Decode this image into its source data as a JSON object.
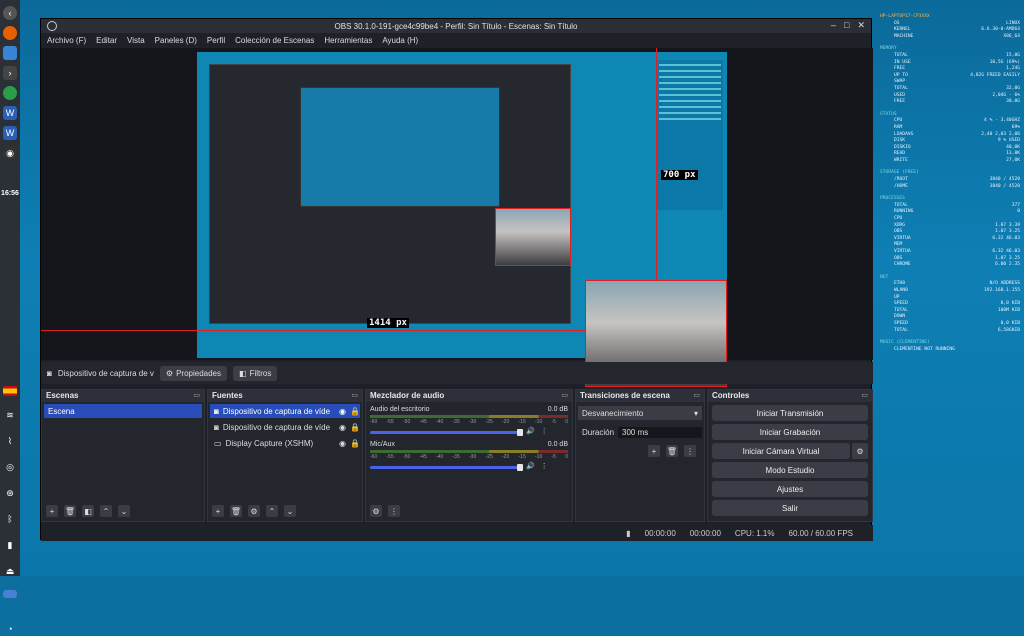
{
  "taskbar": {
    "time": "16:56"
  },
  "window": {
    "title": "OBS 30.1.0-191-gce4c99be4 - Perfil: Sin Título - Escenas: Sin Título"
  },
  "menu": [
    "Archivo (F)",
    "Editar",
    "Vista",
    "Paneles (D)",
    "Perfil",
    "Colección de Escenas",
    "Herramientas",
    "Ayuda (H)"
  ],
  "preview": {
    "label1": "700 px",
    "label2": "1414 px"
  },
  "sourcebar": {
    "source": "Dispositivo de captura de v",
    "props": "Propiedades",
    "filters": "Filtros"
  },
  "docks": {
    "scenes": {
      "title": "Escenas",
      "items": [
        "Escena"
      ]
    },
    "sources": {
      "title": "Fuentes",
      "items": [
        "Dispositivo de captura de víde",
        "Dispositivo de captura de víde",
        "Display Capture (XSHM)"
      ]
    },
    "mixer": {
      "title": "Mezclador de audio",
      "channels": [
        {
          "name": "Audio del escritorio",
          "db": "0.0 dB"
        },
        {
          "name": "Mic/Aux",
          "db": "0.0 dB"
        }
      ],
      "ticks": [
        "-60",
        "-55",
        "-50",
        "-45",
        "-40",
        "-35",
        "-30",
        "-25",
        "-20",
        "-15",
        "-10",
        "-5",
        "0"
      ]
    },
    "transitions": {
      "title": "Transiciones de escena",
      "selected": "Desvanecimiento",
      "duration_label": "Duración",
      "duration": "300 ms"
    },
    "controls": {
      "title": "Controles",
      "buttons": [
        "Iniciar Transmisión",
        "Iniciar Grabación",
        "Iniciar Cámara Virtual",
        "Modo Estudio",
        "Ajustes",
        "Salir"
      ]
    }
  },
  "status": {
    "t1": "00:00:00",
    "t2": "00:00:00",
    "cpu": "CPU: 1.1%",
    "fps": "60.00 / 60.00 FPS"
  },
  "conky": {
    "host": "HP-LAPTOP17-CP3XXX",
    "system": [
      [
        "OS",
        "LINUX"
      ],
      [
        "KERNEL",
        "6.6.30-0-AMD64"
      ],
      [
        "MACHINE",
        "X86_64"
      ]
    ],
    "memory_title": "MEMORY",
    "memory": [
      [
        "TOTAL",
        "15,0G"
      ],
      [
        "IN USE",
        "10,5G (69%)"
      ],
      [
        "FREE",
        "1,24G"
      ],
      [
        "UP TO",
        "4,82G FREED EASILY"
      ],
      [
        "SWAP",
        ""
      ],
      [
        "TOTAL",
        "32,0G"
      ],
      [
        "USED",
        "2,04G - 6%"
      ],
      [
        "FREE",
        "30,0G"
      ]
    ],
    "status_title": "STATUS",
    "status": [
      [
        "CPU",
        "4 % - 3,40GHZ"
      ],
      [
        "RAM",
        "69%"
      ],
      [
        "LOADAVG",
        "2,40 2,03 2,06"
      ],
      [
        "DISK",
        "9 % USED"
      ],
      [
        "DISKIO",
        "40,0K"
      ],
      [
        "READ",
        "13,0K"
      ],
      [
        "WRITE",
        "27,0K"
      ]
    ],
    "storage_title": "STORAGE (FREE)",
    "storage": [
      [
        "/ROOT",
        "3840 / 4520"
      ],
      [
        "/HOME",
        "3840 / 4520"
      ]
    ],
    "processes_title": "PROCESSES",
    "processes": [
      [
        "TOTAL",
        "377"
      ],
      [
        "RUNNING",
        "0"
      ],
      [
        "CPU",
        ""
      ],
      [
        "XORG",
        "1.07 3.39"
      ],
      [
        "OBS",
        "1.07 3.25"
      ],
      [
        "VIRTUA",
        "6.32 46.03"
      ],
      [
        "MEM",
        ""
      ],
      [
        "VIRTUA",
        "6.32 46.03"
      ],
      [
        "OBS",
        "1.07 3.25"
      ],
      [
        "CHROME",
        "6.00 2.35"
      ]
    ],
    "net_title": "NET",
    "net": [
      [
        "ETH0",
        "N/O ADDRESS"
      ],
      [
        "WLAN0",
        "192.168.1.155"
      ],
      [
        "UP",
        ""
      ],
      [
        "SPEED",
        "0,0 KIB"
      ],
      [
        "TOTAL",
        "100M KIB"
      ],
      [
        "DOWN",
        ""
      ],
      [
        "SPEED",
        "0,0 KIB"
      ],
      [
        "TOTAL",
        "6,58GKIB"
      ]
    ],
    "music_title": "MUSIC (CLEMENTINE)",
    "music": "CLEMENTINE NOT RUNNING"
  }
}
